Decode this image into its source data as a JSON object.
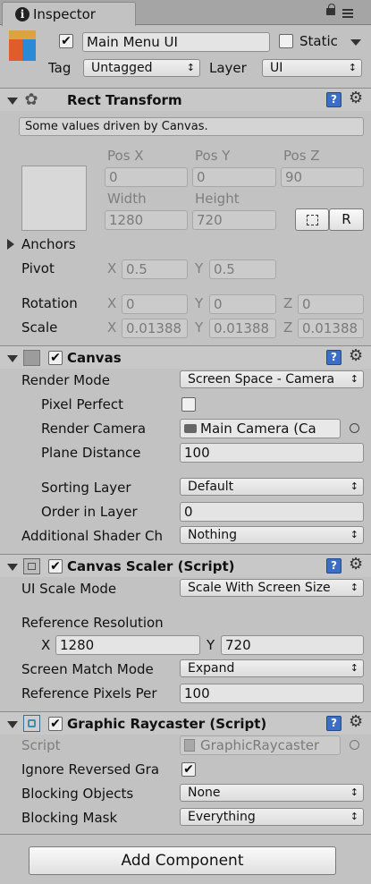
{
  "window": {
    "tab_title": "Inspector"
  },
  "object": {
    "name": "Main Menu UI",
    "active": true,
    "static_label": "Static",
    "static_checked": false,
    "tag_label": "Tag",
    "tag_value": "Untagged",
    "layer_label": "Layer",
    "layer_value": "UI"
  },
  "rect_transform": {
    "title": "Rect Transform",
    "help": "Some values driven by Canvas.",
    "pos_x_label": "Pos X",
    "pos_y_label": "Pos Y",
    "pos_z_label": "Pos Z",
    "pos_x": "0",
    "pos_y": "0",
    "pos_z": "90",
    "width_label": "Width",
    "height_label": "Height",
    "width": "1280",
    "height": "720",
    "r_label": "R",
    "anchors_label": "Anchors",
    "pivot_label": "Pivot",
    "pivot_x": "0.5",
    "pivot_y": "0.5",
    "rotation_label": "Rotation",
    "rot_x": "0",
    "rot_y": "0",
    "rot_z": "0",
    "scale_label": "Scale",
    "scale_x": "0.01388",
    "scale_y": "0.01388",
    "scale_z": "0.01388",
    "x": "X",
    "y": "Y",
    "z": "Z"
  },
  "canvas": {
    "title": "Canvas",
    "enabled": true,
    "render_mode_label": "Render Mode",
    "render_mode": "Screen Space - Camera",
    "pixel_perfect_label": "Pixel Perfect",
    "pixel_perfect": false,
    "render_camera_label": "Render Camera",
    "render_camera": "Main Camera (Ca",
    "plane_distance_label": "Plane Distance",
    "plane_distance": "100",
    "sorting_layer_label": "Sorting Layer",
    "sorting_layer": "Default",
    "order_label": "Order in Layer",
    "order": "0",
    "shader_label": "Additional Shader Ch",
    "shader_value": "Nothing"
  },
  "scaler": {
    "title": "Canvas Scaler (Script)",
    "enabled": true,
    "mode_label": "UI Scale Mode",
    "mode": "Scale With Screen Size",
    "ref_res_label": "Reference Resolution",
    "x_label": "X",
    "y_label": "Y",
    "res_x": "1280",
    "res_y": "720",
    "match_label": "Screen Match Mode",
    "match": "Expand",
    "ppu_label": "Reference Pixels Per",
    "ppu": "100"
  },
  "raycaster": {
    "title": "Graphic Raycaster (Script)",
    "enabled": true,
    "script_label": "Script",
    "script_value": "GraphicRaycaster",
    "ignore_label": "Ignore Reversed Gra",
    "ignore_checked": true,
    "blocking_objects_label": "Blocking Objects",
    "blocking_objects": "None",
    "blocking_mask_label": "Blocking Mask",
    "blocking_mask": "Everything"
  },
  "add_component_label": "Add Component"
}
